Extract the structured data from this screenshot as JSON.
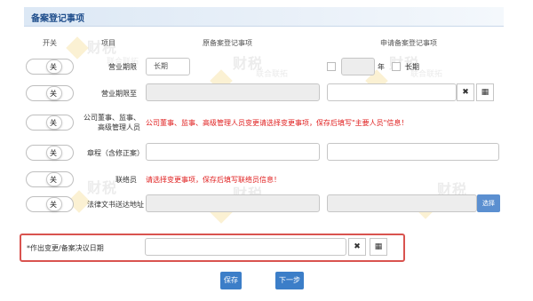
{
  "section": {
    "title": "备案登记事项"
  },
  "columns": {
    "switch": "开关",
    "item": "项目",
    "original": "原备案登记事项",
    "applied": "申请备案登记事项"
  },
  "toggle_label": "关",
  "rows": [
    {
      "label": "营业期限",
      "original_value": "长期",
      "year_label": "年",
      "long_label": "长期"
    },
    {
      "label": "营业期限至"
    },
    {
      "label_line1": "公司董事、监事、",
      "label_line2": "高级管理人员",
      "notice": "公司董事、监事、高级管理人员变更请选择变更事项，保存后填写\"主要人员\"信息！"
    },
    {
      "label": "章程（含修正案）"
    },
    {
      "label": "联络员",
      "notice": "请选择变更事项，保存后填写联络员信息！"
    },
    {
      "label": "法律文书送达地址",
      "select_label": "选择"
    }
  ],
  "decision_date": {
    "label": "*作出变更/备案决议日期",
    "value": ""
  },
  "buttons": {
    "save": "保存",
    "next": "下一步"
  },
  "icons": {
    "clear": "✖",
    "calendar": "▦"
  },
  "colors": {
    "accent": "#3c7ec8",
    "warning": "#e02020",
    "highlight": "#d9534f"
  },
  "watermark": {
    "main": "财税",
    "sub": "联合联拓"
  }
}
